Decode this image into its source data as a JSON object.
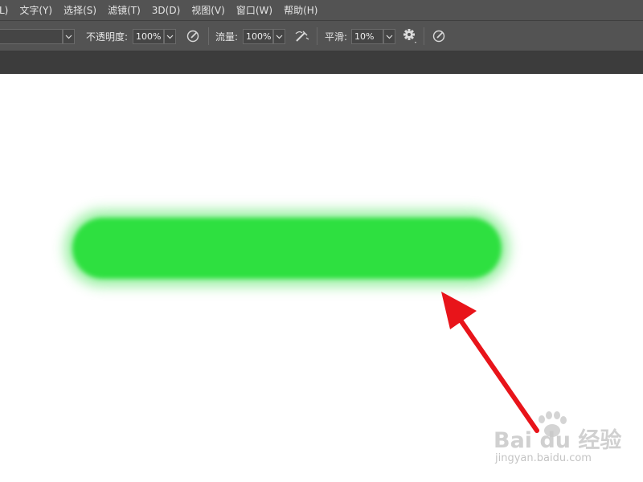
{
  "menubar": {
    "items": [
      {
        "label": "L)"
      },
      {
        "label": "文字(Y)"
      },
      {
        "label": "选择(S)"
      },
      {
        "label": "滤镜(T)"
      },
      {
        "label": "3D(D)"
      },
      {
        "label": "视图(V)"
      },
      {
        "label": "窗口(W)"
      },
      {
        "label": "帮助(H)"
      }
    ]
  },
  "options": {
    "opacity_label": "不透明度:",
    "opacity_value": "100%",
    "flow_label": "流量:",
    "flow_value": "100%",
    "smoothing_label": "平滑:",
    "smoothing_value": "10%"
  },
  "canvas": {
    "brush_color": "#2ee040",
    "arrow_color": "#e8141a"
  },
  "watermark": {
    "logo": "Bai du 经验",
    "url": "jingyan.baidu.com"
  },
  "icons": [
    "pressure-opacity-icon",
    "airbrush-icon",
    "gear-icon",
    "pressure-size-icon",
    "chevron-down-icon",
    "paw-icon"
  ]
}
